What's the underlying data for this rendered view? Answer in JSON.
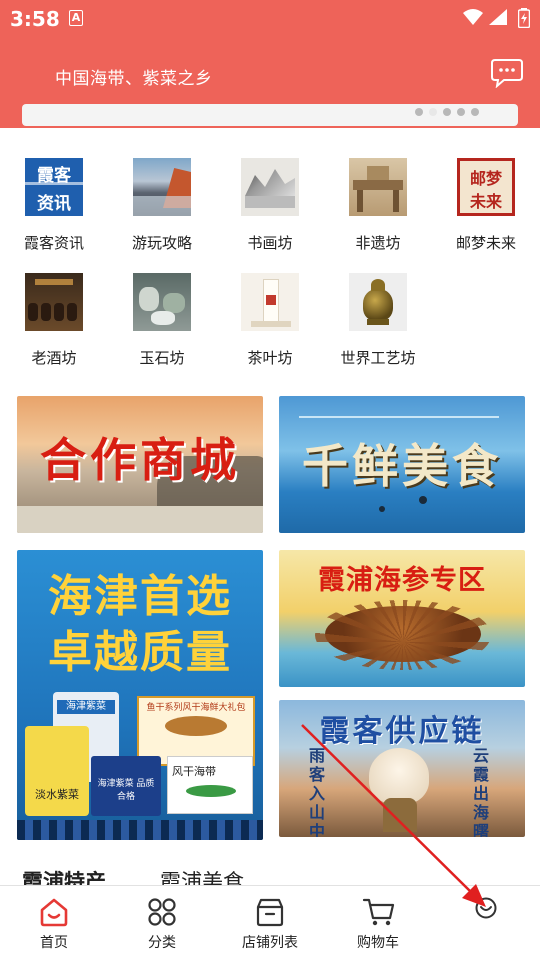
{
  "status_bar": {
    "time": "3:58",
    "notification_letter": "A"
  },
  "header": {
    "slogan": "中国海带、紫菜之乡",
    "message_icon": "chat-bubble-icon",
    "color": "#ee6359"
  },
  "carousel": {
    "total_dots": 5,
    "active_dot": 1
  },
  "categories": [
    {
      "label": "霞客资讯",
      "icon_text_top": "霞客",
      "icon_text_bottom": "资讯"
    },
    {
      "label": "游玩攻略"
    },
    {
      "label": "书画坊"
    },
    {
      "label": "非遗坊"
    },
    {
      "label": "邮梦未来",
      "icon_text_top": "邮梦",
      "icon_text_bottom": "未来"
    },
    {
      "label": "老酒坊"
    },
    {
      "label": "玉石坊"
    },
    {
      "label": "茶叶坊"
    },
    {
      "label": "世界工艺坊"
    }
  ],
  "promo_tiles": {
    "mall": {
      "title": "合作商城"
    },
    "food": {
      "title": "千鲜美食"
    },
    "quality": {
      "line1": "海津首选",
      "line2": "卓越质量",
      "product1": "海津紫菜",
      "product2": "淡水紫菜",
      "product3": "风干海带",
      "product4": "海津紫菜 品质合格",
      "box_banner": "鱼干系列风干海鲜大礼包"
    },
    "sea_cucumber": {
      "title": "霞浦海参专区"
    },
    "supply_chain": {
      "title": "霞客供应链",
      "left_text": "雨客入山中",
      "right_text": "云霞出海曙"
    }
  },
  "content_tabs": [
    {
      "label": "霞浦特产"
    },
    {
      "label": "霞浦美食"
    }
  ],
  "bottom_nav": [
    {
      "label": "首页",
      "icon": "home-icon",
      "active": true
    },
    {
      "label": "分类",
      "icon": "grid-icon",
      "active": false
    },
    {
      "label": "店铺列表",
      "icon": "store-icon",
      "active": false
    },
    {
      "label": "购物车",
      "icon": "cart-icon",
      "active": false
    },
    {
      "label": "",
      "icon": "profile-icon",
      "active": false
    }
  ],
  "colors": {
    "accent": "#ee6359",
    "active_nav": "#e53935",
    "arrow": "#e02020"
  }
}
